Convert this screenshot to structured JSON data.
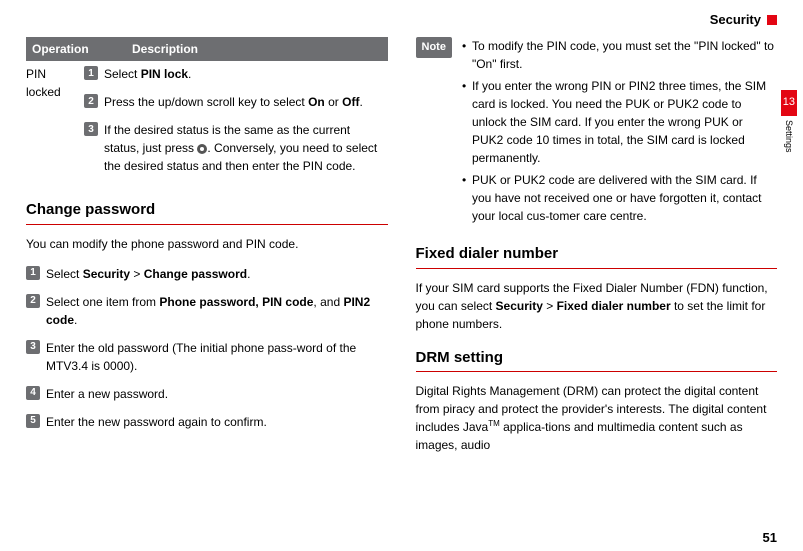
{
  "header": {
    "title": "Security"
  },
  "sideTab": {
    "number": "13",
    "label": "Settings"
  },
  "pageNumber": "51",
  "left": {
    "table": {
      "col1": "Operation",
      "col2": "Description",
      "opName": "PIN locked",
      "step1_pre": "Select ",
      "step1_bold": "PIN lock",
      "step1_post": ".",
      "step2_pre": "Press the up/down scroll key to select ",
      "step2_b1": "On",
      "step2_mid": " or ",
      "step2_b2": "Off",
      "step2_post": ".",
      "step3_pre": "If the desired status is the same as the current status, just press ",
      "step3_post": ". Conversely, you need to select the desired status and then enter the PIN code."
    },
    "changePwd": {
      "heading": "Change password",
      "intro": "You can modify the phone password and PIN code.",
      "s1_pre": "Select ",
      "s1_b1": "Security",
      "s1_gt": " > ",
      "s1_b2": "Change password",
      "s1_post": ".",
      "s2_pre": "Select one item from ",
      "s2_b1": "Phone password, PIN code",
      "s2_mid": ", and ",
      "s2_b2": "PIN2 code",
      "s2_post": ".",
      "s3": "Enter the old password (The initial phone pass-word of the MTV3.4 is 0000).",
      "s4": "Enter a new password.",
      "s5": "Enter the new password again to confirm."
    }
  },
  "right": {
    "noteLabel": "Note",
    "notes": {
      "n1": "To modify the PIN code, you must set the \"PIN locked\" to \"On\" first.",
      "n2": "If you enter the wrong PIN or PIN2 three times, the SIM card is locked. You need the PUK or PUK2 code to unlock the SIM card. If you enter the wrong PUK or PUK2 code 10 times in total, the SIM card is locked permanently.",
      "n3": "PUK or PUK2 code are delivered with the SIM card. If you have not received one or have forgotten it, contact your local cus-tomer care centre."
    },
    "fdn": {
      "heading": "Fixed dialer number",
      "pre": "If your SIM card supports the Fixed Dialer Number (FDN) function, you can select ",
      "b1": "Security",
      "gt": " > ",
      "b2": "Fixed dialer number",
      "post": " to set the limit for phone numbers."
    },
    "drm": {
      "heading": "DRM setting",
      "pre": "Digital Rights Management (DRM) can protect the digital content from piracy and protect the provider's interests. The digital content includes Java",
      "tm": "TM",
      "post": " applica-tions and multimedia content such as images, audio"
    }
  },
  "nums": {
    "n1": "1",
    "n2": "2",
    "n3": "3",
    "n4": "4",
    "n5": "5"
  }
}
